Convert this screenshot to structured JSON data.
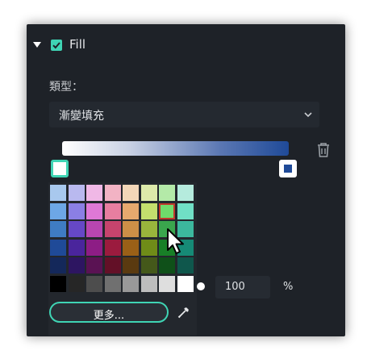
{
  "fill": {
    "label": "Fill",
    "checked": true
  },
  "type": {
    "label": "類型：",
    "selected": "漸變填充"
  },
  "gradient": {
    "start_color": "#ffffff",
    "end_color": "#1f4a98"
  },
  "palette": {
    "colors": [
      "#a8c8ee",
      "#b9b9ef",
      "#f0b8e6",
      "#f2b3c4",
      "#f3d7b8",
      "#ddeaaa",
      "#b4eaa8",
      "#b5ebdd",
      "#6da7e6",
      "#8b7fe4",
      "#df78d6",
      "#e77ea0",
      "#e7a96e",
      "#c4df6d",
      "#6fdc6b",
      "#70dfc5",
      "#3f7cc3",
      "#6648c6",
      "#b846b0",
      "#c6446d",
      "#cc8f47",
      "#99b53c",
      "#3aa64d",
      "#3cb89d",
      "#1f4a98",
      "#4a259c",
      "#8d1d85",
      "#9b1b3e",
      "#9a6017",
      "#6f8c18",
      "#187f27",
      "#168a76",
      "#14285a",
      "#2d1561",
      "#5a1253",
      "#631027",
      "#5a3a10",
      "#44581a",
      "#0f5019",
      "#0f574c",
      "#000000",
      "#262626",
      "#4d4d4d",
      "#707070",
      "#999999",
      "#bdbdbd",
      "#dedede",
      "#ffffff"
    ],
    "more_label": "更多..."
  },
  "opacity": {
    "value": "100",
    "unit": "%"
  },
  "colors": {
    "accent": "#3fd4b4",
    "panel_bg": "#1e2228"
  }
}
